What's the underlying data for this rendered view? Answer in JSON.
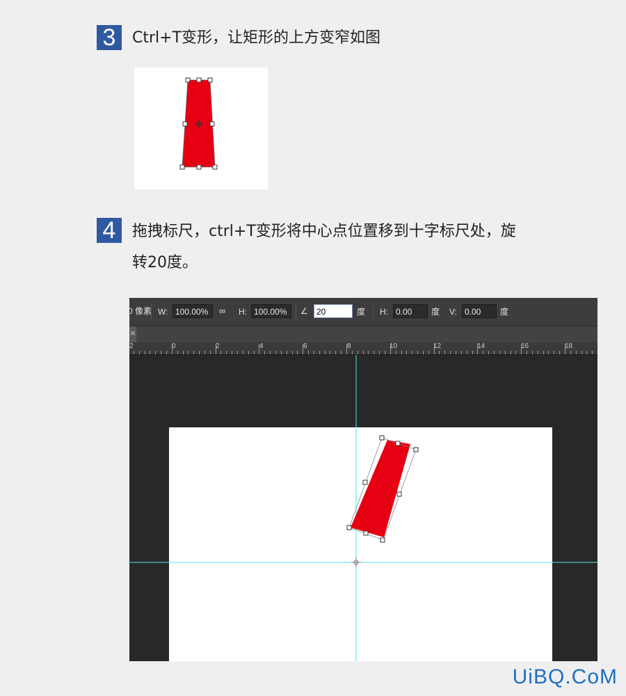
{
  "steps": [
    {
      "number": "3",
      "text": "Ctrl+T变形，让矩形的上方变窄如图"
    },
    {
      "number": "4",
      "text_line1": "拖拽标尺，ctrl+T变形将中心点位置移到十字标尺处，旋",
      "text_line2": "转20度。"
    }
  ],
  "ps": {
    "options": {
      "unit_fragment": "0 像素",
      "w_label": "W:",
      "w_value": "100.00%",
      "h_label": "H:",
      "h_value": "100.00%",
      "angle_value": "20",
      "angle_unit": "度",
      "hskew_label": "H:",
      "hskew_value": "0.00",
      "hskew_unit": "度",
      "vskew_label": "V:",
      "vskew_value": "0.00",
      "vskew_unit": "度"
    },
    "tab_close": "×",
    "ruler_labels": [
      "2",
      "0",
      "2",
      "4",
      "6",
      "8",
      "10",
      "12",
      "14",
      "16",
      "18"
    ]
  },
  "colors": {
    "badge": "#2f5aa0",
    "shape_red": "#e60012",
    "guide_cyan": "#4fe3f0",
    "watermark": "#1f6fc4"
  },
  "watermark": "UiBQ.CoM"
}
